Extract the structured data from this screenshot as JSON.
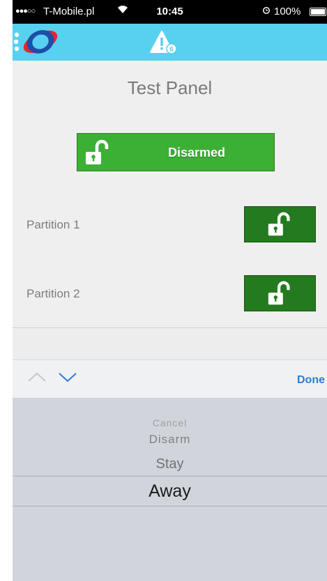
{
  "status_bar": {
    "signal": "●●●○○",
    "carrier": "T-Mobile.pl",
    "time": "10:45",
    "battery": "100%"
  },
  "header": {
    "logo_icon": "app-logo",
    "alert_icon": "warning-badge-icon",
    "alert_badge": "6",
    "background": "#58d0ef"
  },
  "panel": {
    "title": "Test Panel",
    "main_state": "Disarmed",
    "main_color": "#3cb035",
    "partitions": [
      {
        "label": "Partition 1",
        "icon": "unlocked-padlock-icon"
      },
      {
        "label": "Partition 2",
        "icon": "unlocked-padlock-icon"
      }
    ],
    "partition_color": "#247a1e"
  },
  "toolbar": {
    "done_label": "Done",
    "accent": "#2f7bd6"
  },
  "picker": {
    "options": [
      "Cancel",
      "Disarm",
      "Stay",
      "Away"
    ],
    "selected": "Away"
  }
}
